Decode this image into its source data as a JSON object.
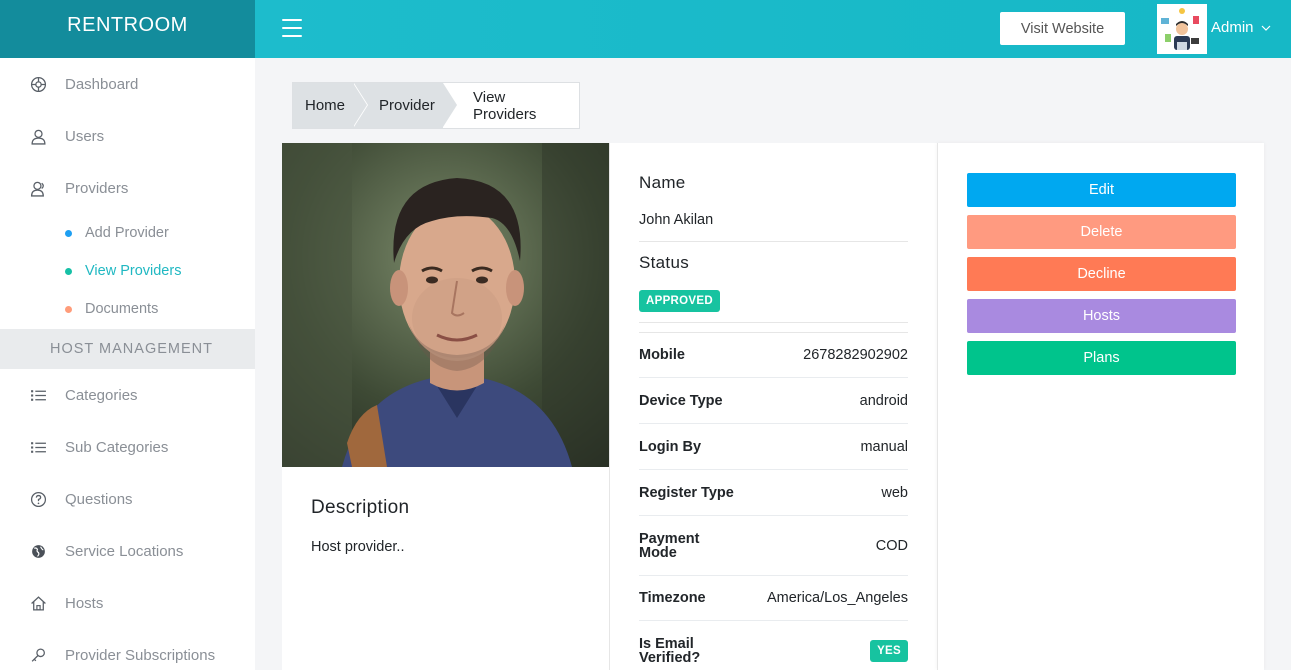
{
  "app": {
    "brand": "RENTROOM"
  },
  "sidebar": {
    "items": [
      {
        "label": "Dashboard",
        "icon": "dashboard-icon"
      },
      {
        "label": "Users",
        "icon": "user-icon"
      },
      {
        "label": "Providers",
        "icon": "providers-icon"
      }
    ],
    "sub_items": [
      {
        "label": "Add Provider",
        "dot_color": "#1e9ff2"
      },
      {
        "label": "View Providers",
        "dot_color": "#16c0a6"
      },
      {
        "label": "Documents",
        "dot_color": "#ff9c7a"
      }
    ],
    "section": "HOST MANAGEMENT",
    "items2": [
      {
        "label": "Categories",
        "icon": "list-icon"
      },
      {
        "label": "Sub Categories",
        "icon": "list-icon"
      },
      {
        "label": "Questions",
        "icon": "question-icon"
      },
      {
        "label": "Service Locations",
        "icon": "globe-icon"
      },
      {
        "label": "Hosts",
        "icon": "home-icon"
      },
      {
        "label": "Provider Subscriptions",
        "icon": "key-icon"
      }
    ]
  },
  "header": {
    "visit_label": "Visit Website",
    "user_name": "Admin"
  },
  "breadcrumb": {
    "home": "Home",
    "provider": "Provider",
    "current": "View Providers"
  },
  "profile": {
    "description_title": "Description",
    "description": "Host provider..",
    "name_label": "Name",
    "name": "John Akilan",
    "status_label": "Status",
    "status": "APPROVED",
    "details": [
      {
        "key": "Mobile",
        "value": "2678282902902"
      },
      {
        "key": "Device Type",
        "value": "android"
      },
      {
        "key": "Login By",
        "value": "manual"
      },
      {
        "key": "Register Type",
        "value": "web"
      },
      {
        "key": "Payment Mode",
        "value": "COD"
      },
      {
        "key": "Timezone",
        "value": "America/Los_Angeles"
      },
      {
        "key": "Is Email Verified?",
        "value": "YES"
      }
    ]
  },
  "actions": {
    "edit": "Edit",
    "delete": "Delete",
    "decline": "Decline",
    "hosts": "Hosts",
    "plans": "Plans"
  },
  "colors": {
    "brand_dark": "#138c9c",
    "topbar": "#1dbccc",
    "edit": "#00a8f0",
    "delete": "#ff9a80",
    "decline": "#ff7a55",
    "hosts": "#a98ae0",
    "plans": "#00c48c",
    "badge": "#17c3a0"
  }
}
